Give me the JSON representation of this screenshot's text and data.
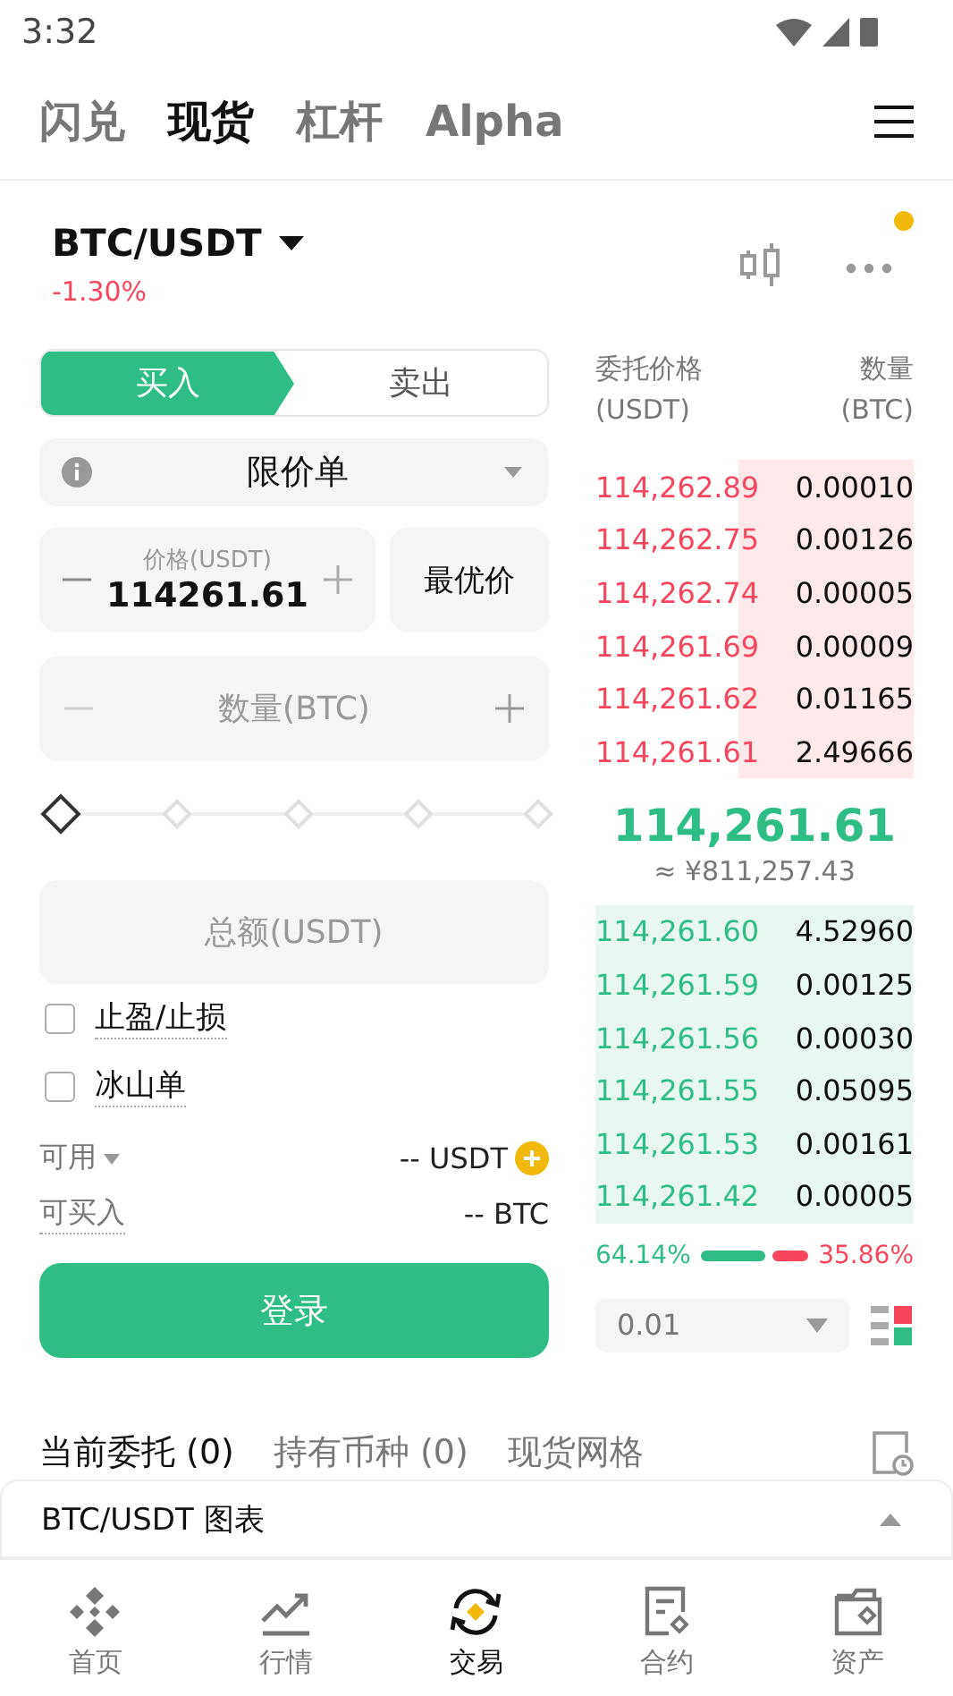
{
  "status_bar": {
    "time": "3:32"
  },
  "top_tabs": [
    {
      "label": "闪兑",
      "selected": false
    },
    {
      "label": "现货",
      "selected": true
    },
    {
      "label": "杠杆",
      "selected": false
    },
    {
      "label": "Alpha",
      "selected": false
    }
  ],
  "pair": {
    "symbol": "BTC/USDT",
    "change": "-1.30%",
    "notification": true
  },
  "side_tabs": [
    {
      "label": "买入",
      "selected": true
    },
    {
      "label": "卖出",
      "selected": false
    }
  ],
  "order_type": "限价单",
  "price_field": {
    "label": "价格(USDT)",
    "value": "114261.61"
  },
  "best_price_button": "最优价",
  "quantity_field": {
    "placeholder": "数量(BTC)"
  },
  "amount_slider": {
    "level": 0
  },
  "total_field": {
    "placeholder": "总额(USDT)"
  },
  "options": [
    {
      "label": "止盈/止损",
      "checked": false
    },
    {
      "label": "冰山单",
      "checked": false
    }
  ],
  "available": {
    "label": "可用",
    "value": "-- USDT"
  },
  "buyable": {
    "label": "可买入",
    "value": "-- BTC"
  },
  "login_button": "登录",
  "order_book": {
    "price_header": "委托价格",
    "price_unit": "(USDT)",
    "qty_header": "数量",
    "qty_unit": "(BTC)",
    "asks": [
      {
        "price": "114,262.89",
        "qty": "0.00010"
      },
      {
        "price": "114,262.75",
        "qty": "0.00126"
      },
      {
        "price": "114,262.74",
        "qty": "0.00005"
      },
      {
        "price": "114,261.69",
        "qty": "0.00009"
      },
      {
        "price": "114,261.62",
        "qty": "0.01165"
      },
      {
        "price": "114,261.61",
        "qty": "2.49666"
      }
    ],
    "last_price": "114,261.61",
    "last_price_cny": "≈ ¥811,257.43",
    "bids": [
      {
        "price": "114,261.60",
        "qty": "4.52960"
      },
      {
        "price": "114,261.59",
        "qty": "0.00125"
      },
      {
        "price": "114,261.56",
        "qty": "0.00030"
      },
      {
        "price": "114,261.55",
        "qty": "0.05095"
      },
      {
        "price": "114,261.53",
        "qty": "0.00161"
      },
      {
        "price": "114,261.42",
        "qty": "0.00005"
      }
    ],
    "buy_ratio": "64.14%",
    "sell_ratio": "35.86%",
    "ratio": {
      "level": 0.6414
    },
    "precision": "0.01"
  },
  "order_tabs": [
    {
      "label": "当前委托 (0)",
      "selected": true
    },
    {
      "label": "持有币种 (0)",
      "selected": false
    },
    {
      "label": "现货网格",
      "selected": false
    }
  ],
  "chart_bar": {
    "label": "BTC/USDT 图表"
  },
  "bottom_nav": [
    {
      "label": "首页",
      "kind": "home",
      "selected": false
    },
    {
      "label": "行情",
      "kind": "markets",
      "selected": false
    },
    {
      "label": "交易",
      "kind": "trade",
      "selected": true
    },
    {
      "label": "合约",
      "kind": "futures",
      "selected": false
    },
    {
      "label": "资产",
      "kind": "wallet",
      "selected": false
    }
  ]
}
